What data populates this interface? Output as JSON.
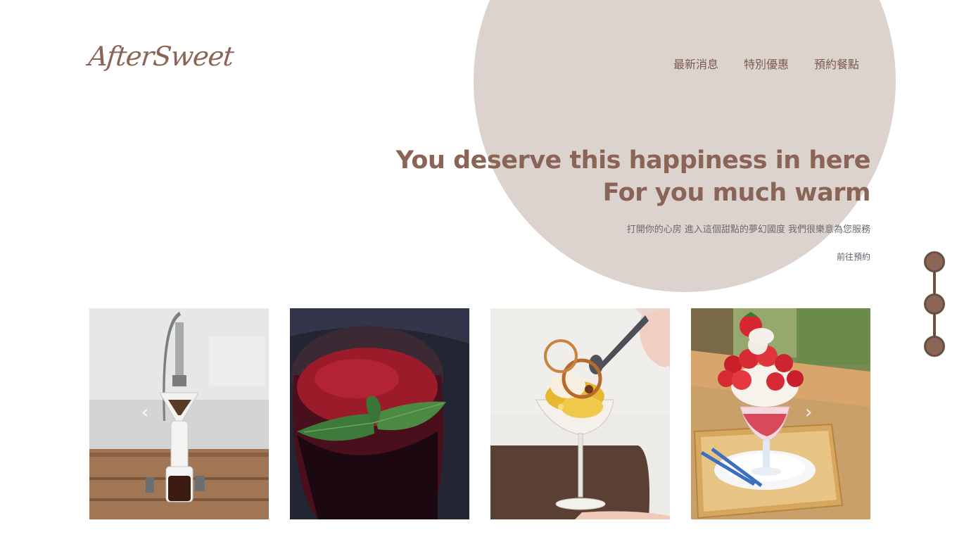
{
  "brand": {
    "logo_text": "AfterSweet"
  },
  "nav": {
    "items": [
      {
        "label": "最新消息"
      },
      {
        "label": "特別優惠"
      },
      {
        "label": "預約餐點"
      }
    ]
  },
  "hero": {
    "headline_line1": "You deserve this happiness in here",
    "headline_line2": "For you much warm",
    "subtitle": "打開你的心房 進入這個甜點的夢幻國度 我們很樂意為您服務",
    "cta_label": "前往預約"
  },
  "carousel": {
    "prev_icon": "chevron-left-icon",
    "next_icon": "chevron-right-icon",
    "prev_glyph": "‹",
    "next_glyph": "›",
    "photos": [
      {
        "icon": "pour-over-coffee-photo"
      },
      {
        "icon": "berry-smoothie-photo"
      },
      {
        "icon": "ice-cream-parfait-photo"
      },
      {
        "icon": "strawberry-parfait-photo"
      }
    ]
  },
  "side_pager": {
    "dots": 3
  },
  "colors": {
    "accent": "#8a6557",
    "circle_bg": "#ddd3ce",
    "dot_fill": "#8b6556",
    "dot_border": "#6d4e42"
  }
}
